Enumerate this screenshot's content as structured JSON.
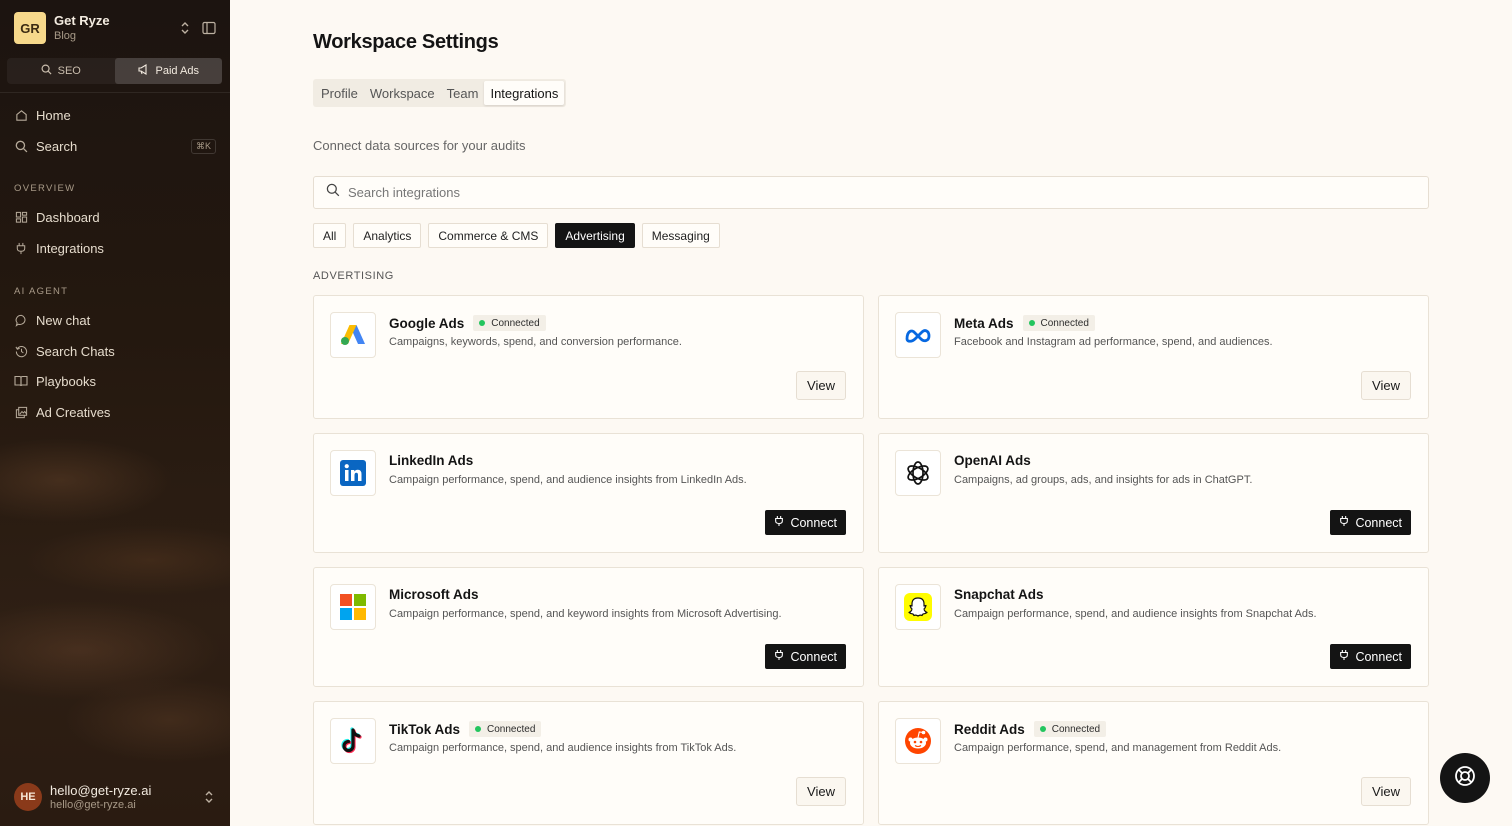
{
  "workspace": {
    "initials": "GR",
    "name": "Get Ryze",
    "subtitle": "Blog"
  },
  "mode_switch": [
    {
      "label": "SEO",
      "icon": "search-icon",
      "active": false
    },
    {
      "label": "Paid Ads",
      "icon": "megaphone-icon",
      "active": true
    }
  ],
  "nav": {
    "home": "Home",
    "search": "Search",
    "search_shortcut": "⌘K",
    "overview_label": "OVERVIEW",
    "dashboard": "Dashboard",
    "integrations": "Integrations",
    "ai_agent_label": "AI AGENT",
    "new_chat": "New chat",
    "search_chats": "Search Chats",
    "playbooks": "Playbooks",
    "ad_creatives": "Ad Creatives"
  },
  "user": {
    "initials": "HE",
    "name": "hello@get-ryze.ai",
    "email": "hello@get-ryze.ai"
  },
  "page": {
    "title": "Workspace Settings",
    "tabs": [
      "Profile",
      "Workspace",
      "Team",
      "Integrations"
    ],
    "active_tab": "Integrations",
    "subtitle": "Connect data sources for your audits",
    "search_placeholder": "Search integrations",
    "filters": [
      "All",
      "Analytics",
      "Commerce & CMS",
      "Advertising",
      "Messaging"
    ],
    "active_filter": "Advertising",
    "category_label": "ADVERTISING"
  },
  "integrations": [
    {
      "name": "Google Ads",
      "icon": "google-ads-icon",
      "connected": true,
      "status": "Connected",
      "description": "Campaigns, keywords, spend, and conversion performance.",
      "action": "View"
    },
    {
      "name": "Meta Ads",
      "icon": "meta-icon",
      "connected": true,
      "status": "Connected",
      "description": "Facebook and Instagram ad performance, spend, and audiences.",
      "action": "View"
    },
    {
      "name": "LinkedIn Ads",
      "icon": "linkedin-icon",
      "connected": false,
      "description": "Campaign performance, spend, and audience insights from LinkedIn Ads.",
      "action": "Connect"
    },
    {
      "name": "OpenAI Ads",
      "icon": "openai-icon",
      "connected": false,
      "description": "Campaigns, ad groups, ads, and insights for ads in ChatGPT.",
      "action": "Connect"
    },
    {
      "name": "Microsoft Ads",
      "icon": "microsoft-icon",
      "connected": false,
      "description": "Campaign performance, spend, and keyword insights from Microsoft Advertising.",
      "action": "Connect"
    },
    {
      "name": "Snapchat Ads",
      "icon": "snapchat-icon",
      "connected": false,
      "description": "Campaign performance, spend, and audience insights from Snapchat Ads.",
      "action": "Connect"
    },
    {
      "name": "TikTok Ads",
      "icon": "tiktok-icon",
      "connected": true,
      "status": "Connected",
      "description": "Campaign performance, spend, and audience insights from TikTok Ads.",
      "action": "View"
    },
    {
      "name": "Reddit Ads",
      "icon": "reddit-icon",
      "connected": true,
      "status": "Connected",
      "description": "Campaign performance, spend, and management from Reddit Ads.",
      "action": "View"
    }
  ],
  "colors": {
    "accent": "#141414",
    "connected_dot": "#22c55e",
    "background": "#fdf9f3",
    "sidebar": "#24180f"
  }
}
